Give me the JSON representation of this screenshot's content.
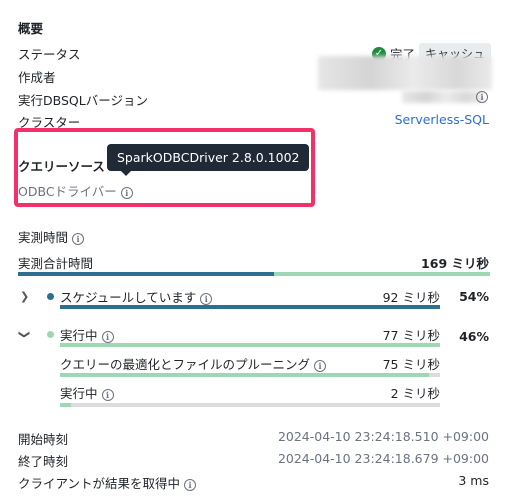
{
  "overview": {
    "title": "概要",
    "status_label": "ステータス",
    "status_value": "完了",
    "cache_badge": "キャッシュ",
    "author_label": "作成者",
    "dbsql_version_label": "実行DBSQLバージョン",
    "cluster_label": "クラスター",
    "cluster_value": "Serverless-SQL"
  },
  "query_source": {
    "label": "クエリーソース",
    "driver_label": "ODBCドライバー",
    "tooltip": "SparkODBCDriver 2.8.0.1002"
  },
  "timing": {
    "measured_time_label": "実測時間",
    "total_label": "実測合計時間",
    "total_value": "169 ミリ秒",
    "colors": {
      "blue": "#2e6e8e",
      "green": "#9ed7b4",
      "track": "#dcdcdc"
    },
    "rows": [
      {
        "label": "スケジュールしています",
        "value": "92 ミリ秒",
        "percent": "54%",
        "fraction": 0.54
      },
      {
        "label": "実行中",
        "value": "77 ミリ秒",
        "percent": "46%",
        "fraction": 0.46
      }
    ],
    "sub_rows": [
      {
        "label": "クエリーの最適化とファイルのプルーニング",
        "value": "75 ミリ秒",
        "fraction": 0.97
      },
      {
        "label": "実行中",
        "value": "2 ミリ秒",
        "fraction": 0.03
      }
    ]
  },
  "times": {
    "start_label": "開始時刻",
    "start_value": "2024-04-10 23:24:18.510 +09:00",
    "end_label": "終了時刻",
    "end_value": "2024-04-10 23:24:18.679 +09:00",
    "client_fetch_label": "クライアントが結果を取得中",
    "client_fetch_value": "3 ms"
  },
  "icons": {
    "status": "check-circle-icon",
    "info": "info-icon",
    "expand": "chevron-right-icon",
    "collapse": "chevron-down-icon"
  }
}
